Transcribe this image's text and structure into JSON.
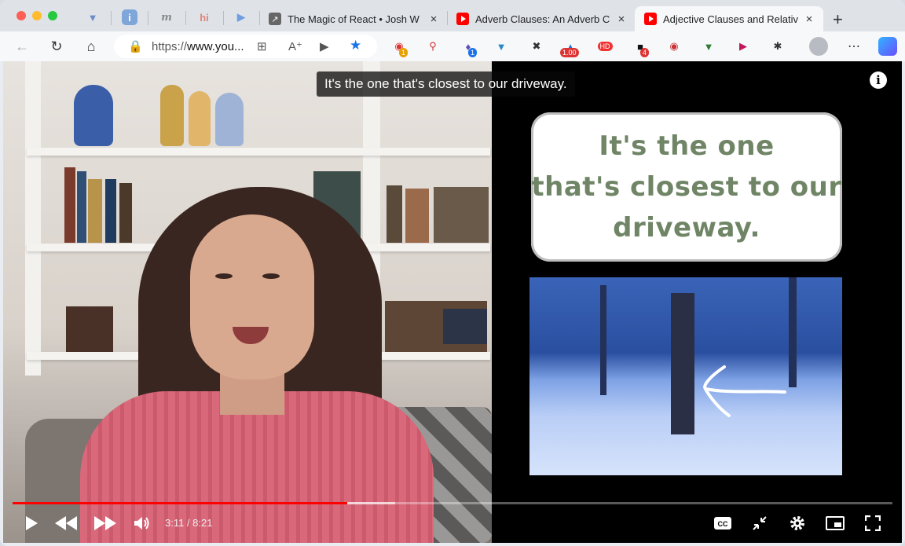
{
  "tabs": {
    "pinned": [
      {
        "name": "pinned-v"
      },
      {
        "name": "pinned-blue"
      },
      {
        "name": "pinned-m",
        "text": "m"
      },
      {
        "name": "pinned-hi",
        "text": "hi"
      },
      {
        "name": "pinned-d"
      }
    ],
    "items": [
      {
        "title": "The Magic of React • Josh W Comeau",
        "close": "×"
      },
      {
        "title": "Adverb Clauses: An Adverb Clause",
        "close": "×"
      },
      {
        "title": "Adjective Clauses and Relative Pronouns",
        "close": "×"
      }
    ],
    "new_tab": "+"
  },
  "toolbar": {
    "url_prefix": "https://",
    "url_host": "www.you..."
  },
  "extensions": {
    "badge_1": "1",
    "badge_2": "1",
    "badge_speed": "1.00",
    "badge_hd": "HD",
    "badge_4": "4"
  },
  "video": {
    "caption": "It's the one that's closest to our driveway.",
    "slide_text_line1": "It's the one",
    "slide_text_line2": "that's closest to our",
    "slide_text_line3": "driveway.",
    "time": "3:11 / 8:21",
    "progress": 0.38,
    "buffered": 0.435
  },
  "colors": {
    "accent": "#ff0000",
    "slide_text": "#6f8566"
  }
}
